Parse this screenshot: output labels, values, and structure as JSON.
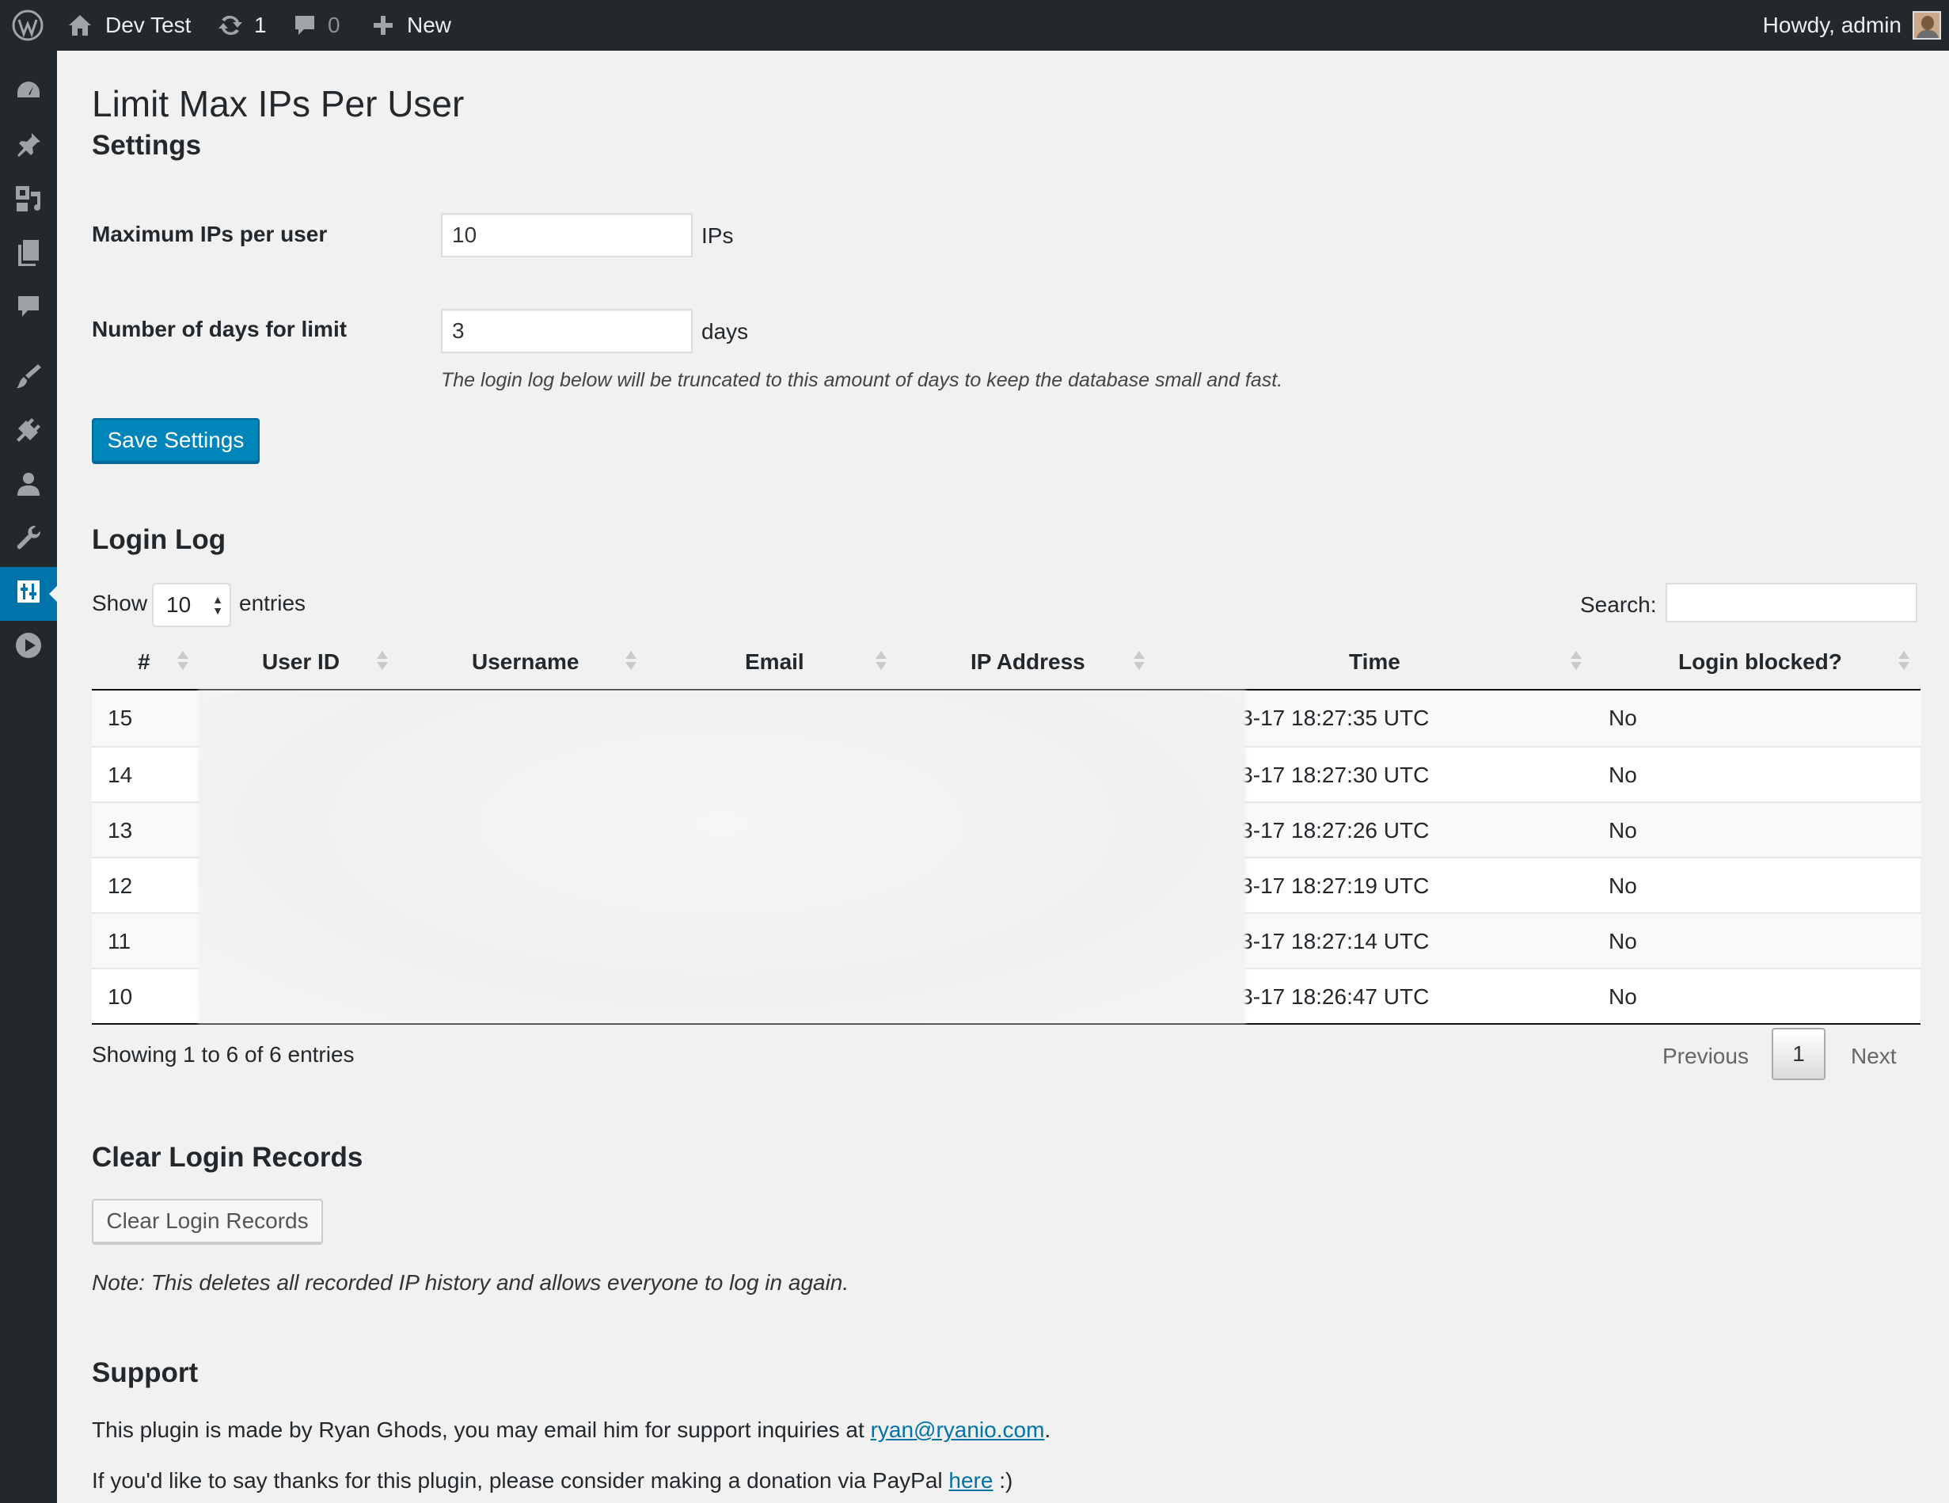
{
  "adminbar": {
    "site_name": "Dev Test",
    "updates_count": "1",
    "comments_count": "0",
    "new_label": "New",
    "account_label": "Howdy, admin"
  },
  "sidebar": {
    "icons": [
      "dashboard-icon",
      "posts-icon",
      "media-icon",
      "pages-icon",
      "comments-icon",
      "appearance-icon",
      "plugins-icon",
      "users-icon",
      "tools-icon",
      "settings-icon",
      "video-icon"
    ],
    "current": "settings-icon"
  },
  "page": {
    "title": "Limit Max IPs Per User",
    "settings_heading": "Settings"
  },
  "settings": {
    "max_ips_label": "Maximum IPs per user",
    "max_ips_value": "10",
    "max_ips_unit": "IPs",
    "days_label": "Number of days for limit",
    "days_value": "3",
    "days_unit": "days",
    "days_description": "The login log below will be truncated to this amount of days to keep the database small and fast.",
    "save_label": "Save Settings"
  },
  "login_log": {
    "heading": "Login Log",
    "show_label": "Show",
    "entries_value": "10",
    "entries_label": "entries",
    "search_label": "Search:",
    "columns": [
      "#",
      "User ID",
      "Username",
      "Email",
      "IP Address",
      "Time",
      "Login blocked?"
    ],
    "rows": [
      {
        "id": "15",
        "time": "2017-03-17 18:27:35 UTC",
        "blocked": "No"
      },
      {
        "id": "14",
        "time": "2017-03-17 18:27:30 UTC",
        "blocked": "No"
      },
      {
        "id": "13",
        "time": "2017-03-17 18:27:26 UTC",
        "blocked": "No"
      },
      {
        "id": "12",
        "time": "2017-03-17 18:27:19 UTC",
        "blocked": "No"
      },
      {
        "id": "11",
        "time": "2017-03-17 18:27:14 UTC",
        "blocked": "No"
      },
      {
        "id": "10",
        "time": "2017-03-17 18:26:47 UTC",
        "blocked": "No"
      }
    ],
    "info": "Showing 1 to 6 of 6 entries",
    "previous_label": "Previous",
    "current_page": "1",
    "next_label": "Next"
  },
  "clear": {
    "heading": "Clear Login Records",
    "button_label": "Clear Login Records",
    "note": "Note: This deletes all recorded IP history and allows everyone to log in again."
  },
  "support": {
    "heading": "Support",
    "line1_prefix": "This plugin is made by Ryan Ghods, you may email him for support inquiries at ",
    "email": "ryan@ryanio.com",
    "line1_suffix": ".",
    "line2_prefix": "If you'd like to say thanks for this plugin, please consider making a donation via PayPal ",
    "link_label": "here",
    "line2_suffix": " :)"
  },
  "colors": {
    "adminbar_bg": "#23282d",
    "primary_button": "#0085ba",
    "link": "#0073aa",
    "page_bg": "#f1f1f1"
  }
}
